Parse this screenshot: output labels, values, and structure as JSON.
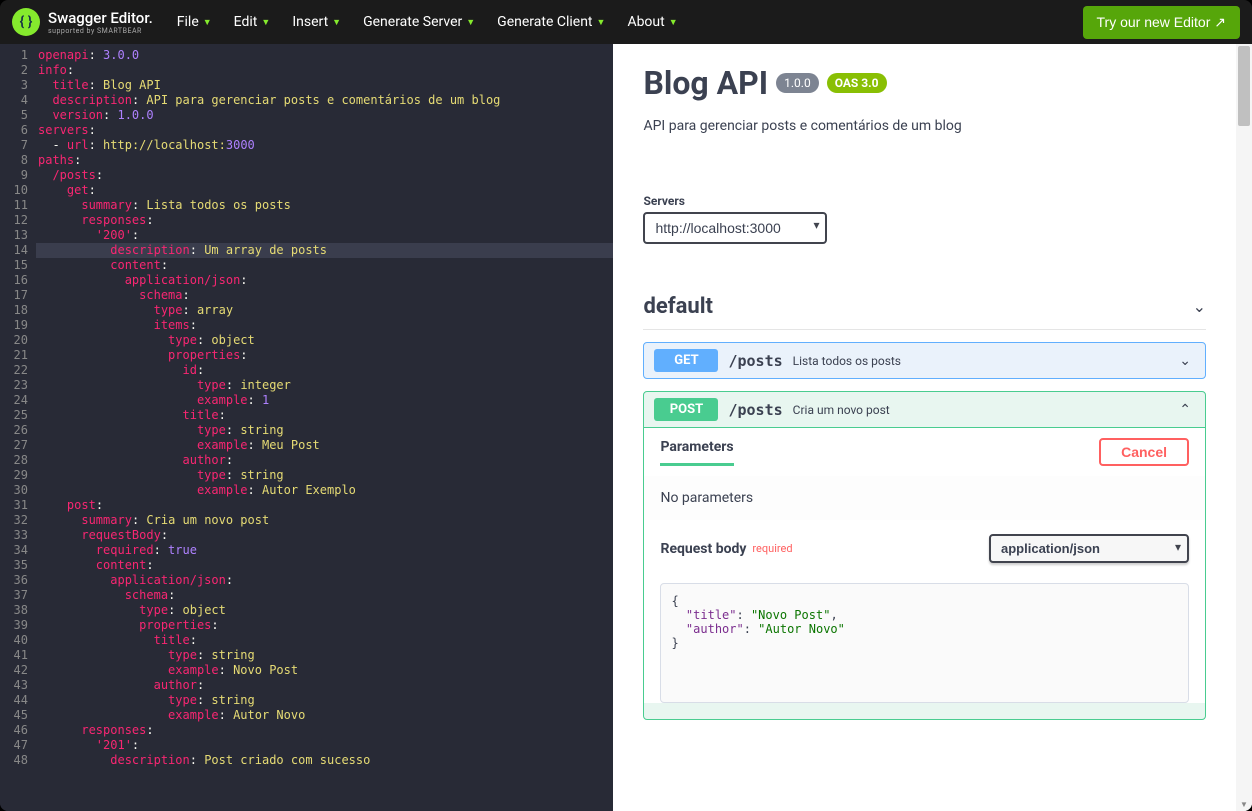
{
  "topbar": {
    "logo_text": "Swagger Editor.",
    "logo_sub": "supported by SMARTBEAR",
    "menus": [
      "File",
      "Edit",
      "Insert",
      "Generate Server",
      "Generate Client",
      "About"
    ],
    "try_btn": "Try our new Editor ↗"
  },
  "editor": {
    "highlight_line": 14,
    "lines": [
      [
        [
          "k",
          "openapi"
        ],
        [
          "p",
          ": "
        ],
        [
          "n",
          "3.0.0"
        ]
      ],
      [
        [
          "k",
          "info"
        ],
        [
          "p",
          ":"
        ]
      ],
      [
        [
          "p",
          "  "
        ],
        [
          "k",
          "title"
        ],
        [
          "p",
          ": "
        ],
        [
          "s",
          "Blog API"
        ]
      ],
      [
        [
          "p",
          "  "
        ],
        [
          "k",
          "description"
        ],
        [
          "p",
          ": "
        ],
        [
          "s",
          "API para gerenciar posts e comentários de um blog"
        ]
      ],
      [
        [
          "p",
          "  "
        ],
        [
          "k",
          "version"
        ],
        [
          "p",
          ": "
        ],
        [
          "n",
          "1.0.0"
        ]
      ],
      [
        [
          "k",
          "servers"
        ],
        [
          "p",
          ":"
        ]
      ],
      [
        [
          "p",
          "  - "
        ],
        [
          "k",
          "url"
        ],
        [
          "p",
          ": "
        ],
        [
          "s",
          "http://localhost:"
        ],
        [
          "n",
          "3000"
        ]
      ],
      [
        [
          "k",
          "paths"
        ],
        [
          "p",
          ":"
        ]
      ],
      [
        [
          "p",
          "  "
        ],
        [
          "k",
          "/posts"
        ],
        [
          "p",
          ":"
        ]
      ],
      [
        [
          "p",
          "    "
        ],
        [
          "k",
          "get"
        ],
        [
          "p",
          ":"
        ]
      ],
      [
        [
          "p",
          "      "
        ],
        [
          "k",
          "summary"
        ],
        [
          "p",
          ": "
        ],
        [
          "s",
          "Lista todos os posts"
        ]
      ],
      [
        [
          "p",
          "      "
        ],
        [
          "k",
          "responses"
        ],
        [
          "p",
          ":"
        ]
      ],
      [
        [
          "p",
          "        "
        ],
        [
          "k",
          "'200'"
        ],
        [
          "p",
          ":"
        ]
      ],
      [
        [
          "p",
          "          "
        ],
        [
          "k",
          "description"
        ],
        [
          "p",
          ": "
        ],
        [
          "s",
          "Um array de posts"
        ]
      ],
      [
        [
          "p",
          "          "
        ],
        [
          "k",
          "content"
        ],
        [
          "p",
          ":"
        ]
      ],
      [
        [
          "p",
          "            "
        ],
        [
          "k",
          "application/json"
        ],
        [
          "p",
          ":"
        ]
      ],
      [
        [
          "p",
          "              "
        ],
        [
          "k",
          "schema"
        ],
        [
          "p",
          ":"
        ]
      ],
      [
        [
          "p",
          "                "
        ],
        [
          "k",
          "type"
        ],
        [
          "p",
          ": "
        ],
        [
          "s",
          "array"
        ]
      ],
      [
        [
          "p",
          "                "
        ],
        [
          "k",
          "items"
        ],
        [
          "p",
          ":"
        ]
      ],
      [
        [
          "p",
          "                  "
        ],
        [
          "k",
          "type"
        ],
        [
          "p",
          ": "
        ],
        [
          "s",
          "object"
        ]
      ],
      [
        [
          "p",
          "                  "
        ],
        [
          "k",
          "properties"
        ],
        [
          "p",
          ":"
        ]
      ],
      [
        [
          "p",
          "                    "
        ],
        [
          "k",
          "id"
        ],
        [
          "p",
          ":"
        ]
      ],
      [
        [
          "p",
          "                      "
        ],
        [
          "k",
          "type"
        ],
        [
          "p",
          ": "
        ],
        [
          "s",
          "integer"
        ]
      ],
      [
        [
          "p",
          "                      "
        ],
        [
          "k",
          "example"
        ],
        [
          "p",
          ": "
        ],
        [
          "n",
          "1"
        ]
      ],
      [
        [
          "p",
          "                    "
        ],
        [
          "k",
          "title"
        ],
        [
          "p",
          ":"
        ]
      ],
      [
        [
          "p",
          "                      "
        ],
        [
          "k",
          "type"
        ],
        [
          "p",
          ": "
        ],
        [
          "s",
          "string"
        ]
      ],
      [
        [
          "p",
          "                      "
        ],
        [
          "k",
          "example"
        ],
        [
          "p",
          ": "
        ],
        [
          "s",
          "Meu Post"
        ]
      ],
      [
        [
          "p",
          "                    "
        ],
        [
          "k",
          "author"
        ],
        [
          "p",
          ":"
        ]
      ],
      [
        [
          "p",
          "                      "
        ],
        [
          "k",
          "type"
        ],
        [
          "p",
          ": "
        ],
        [
          "s",
          "string"
        ]
      ],
      [
        [
          "p",
          "                      "
        ],
        [
          "k",
          "example"
        ],
        [
          "p",
          ": "
        ],
        [
          "s",
          "Autor Exemplo"
        ]
      ],
      [
        [
          "p",
          "    "
        ],
        [
          "k",
          "post"
        ],
        [
          "p",
          ":"
        ]
      ],
      [
        [
          "p",
          "      "
        ],
        [
          "k",
          "summary"
        ],
        [
          "p",
          ": "
        ],
        [
          "s",
          "Cria um novo post"
        ]
      ],
      [
        [
          "p",
          "      "
        ],
        [
          "k",
          "requestBody"
        ],
        [
          "p",
          ":"
        ]
      ],
      [
        [
          "p",
          "        "
        ],
        [
          "k",
          "required"
        ],
        [
          "p",
          ": "
        ],
        [
          "b",
          "true"
        ]
      ],
      [
        [
          "p",
          "        "
        ],
        [
          "k",
          "content"
        ],
        [
          "p",
          ":"
        ]
      ],
      [
        [
          "p",
          "          "
        ],
        [
          "k",
          "application/json"
        ],
        [
          "p",
          ":"
        ]
      ],
      [
        [
          "p",
          "            "
        ],
        [
          "k",
          "schema"
        ],
        [
          "p",
          ":"
        ]
      ],
      [
        [
          "p",
          "              "
        ],
        [
          "k",
          "type"
        ],
        [
          "p",
          ": "
        ],
        [
          "s",
          "object"
        ]
      ],
      [
        [
          "p",
          "              "
        ],
        [
          "k",
          "properties"
        ],
        [
          "p",
          ":"
        ]
      ],
      [
        [
          "p",
          "                "
        ],
        [
          "k",
          "title"
        ],
        [
          "p",
          ":"
        ]
      ],
      [
        [
          "p",
          "                  "
        ],
        [
          "k",
          "type"
        ],
        [
          "p",
          ": "
        ],
        [
          "s",
          "string"
        ]
      ],
      [
        [
          "p",
          "                  "
        ],
        [
          "k",
          "example"
        ],
        [
          "p",
          ": "
        ],
        [
          "s",
          "Novo Post"
        ]
      ],
      [
        [
          "p",
          "                "
        ],
        [
          "k",
          "author"
        ],
        [
          "p",
          ":"
        ]
      ],
      [
        [
          "p",
          "                  "
        ],
        [
          "k",
          "type"
        ],
        [
          "p",
          ": "
        ],
        [
          "s",
          "string"
        ]
      ],
      [
        [
          "p",
          "                  "
        ],
        [
          "k",
          "example"
        ],
        [
          "p",
          ": "
        ],
        [
          "s",
          "Autor Novo"
        ]
      ],
      [
        [
          "p",
          "      "
        ],
        [
          "k",
          "responses"
        ],
        [
          "p",
          ":"
        ]
      ],
      [
        [
          "p",
          "        "
        ],
        [
          "k",
          "'201'"
        ],
        [
          "p",
          ":"
        ]
      ],
      [
        [
          "p",
          "          "
        ],
        [
          "k",
          "description"
        ],
        [
          "p",
          ": "
        ],
        [
          "s",
          "Post criado com sucesso"
        ]
      ]
    ]
  },
  "doc": {
    "title": "Blog API",
    "version": "1.0.0",
    "oas": "OAS 3.0",
    "description": "API para gerenciar posts e comentários de um blog",
    "servers_label": "Servers",
    "server": "http://localhost:3000",
    "tag": "default",
    "ops": [
      {
        "method": "GET",
        "path": "/posts",
        "summary": "Lista todos os posts",
        "expanded": false
      },
      {
        "method": "POST",
        "path": "/posts",
        "summary": "Cria um novo post",
        "expanded": true
      }
    ],
    "params_title": "Parameters",
    "cancel": "Cancel",
    "no_params": "No parameters",
    "reqbody_title": "Request body",
    "required": "required",
    "content_type": "application/json",
    "example": "{\n  \"title\": \"Novo Post\",\n  \"author\": \"Autor Novo\"\n}"
  }
}
